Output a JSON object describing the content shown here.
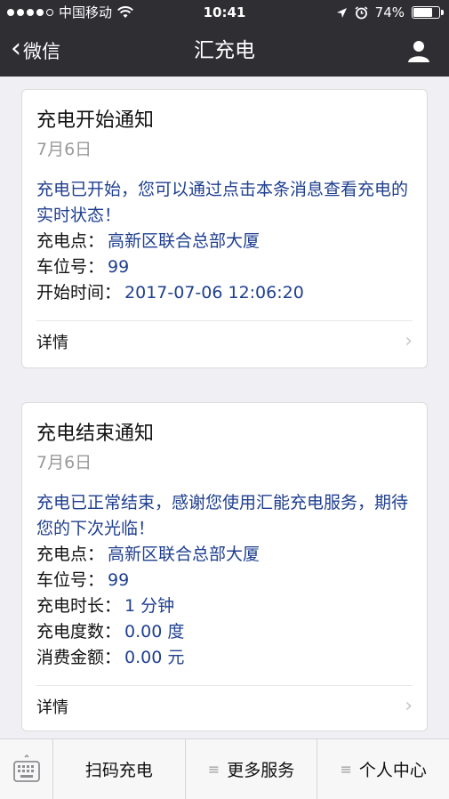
{
  "status_bar": {
    "carrier": "中国移动",
    "time": "10:41",
    "battery_percent": "74%",
    "signal_dots_filled": 4,
    "signal_dots_total": 5
  },
  "nav": {
    "back_label": "微信",
    "title": "汇充电"
  },
  "cards": [
    {
      "title": "充电开始通知",
      "date": "7月6日",
      "message": "充电已开始，您可以通过点击本条消息查看充电的实时状态！",
      "fields": [
        {
          "label": "充电点：",
          "value": "高新区联合总部大厦"
        },
        {
          "label": "车位号：",
          "value": "99"
        },
        {
          "label": "开始时间：",
          "value": "2017-07-06 12:06:20"
        }
      ],
      "detail_label": "详情"
    },
    {
      "title": "充电结束通知",
      "date": "7月6日",
      "message": "充电已正常结束，感谢您使用汇能充电服务，期待您的下次光临！",
      "fields": [
        {
          "label": "充电点：",
          "value": "高新区联合总部大厦"
        },
        {
          "label": "车位号：",
          "value": "99"
        },
        {
          "label": "充电时长：",
          "value": "1 分钟"
        },
        {
          "label": "充电度数：",
          "value": "0.00 度"
        },
        {
          "label": "消费金额：",
          "value": "0.00 元"
        }
      ],
      "detail_label": "详情"
    }
  ],
  "bottom_bar": {
    "tabs": [
      {
        "label": "扫码充电",
        "has_menu_icon": false
      },
      {
        "label": "更多服务",
        "has_menu_icon": true
      },
      {
        "label": "个人中心",
        "has_menu_icon": true
      }
    ]
  },
  "colors": {
    "nav_background": "#2f2e33",
    "message_text": "#1f3f8f",
    "page_background": "#efeff4"
  }
}
